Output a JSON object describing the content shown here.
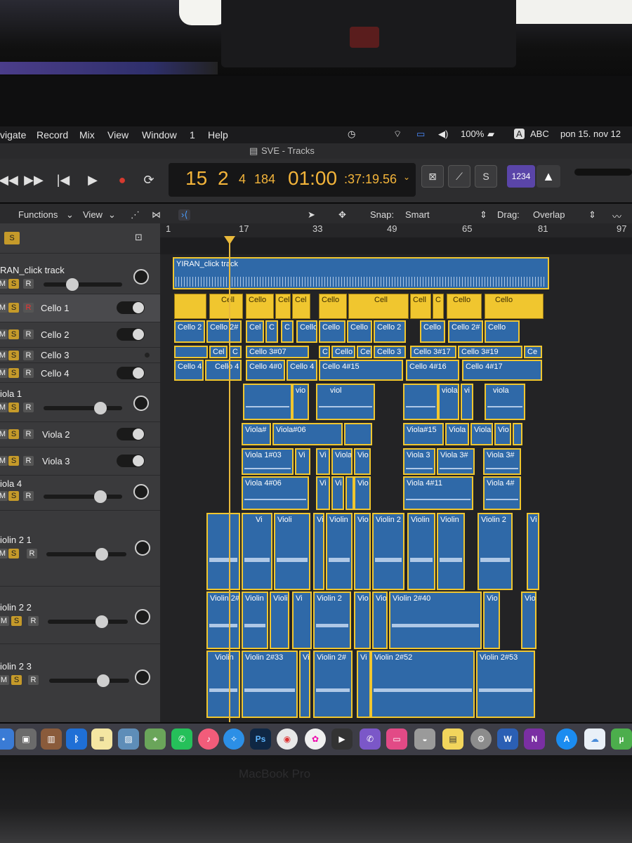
{
  "menubar": {
    "items": [
      "vigate",
      "Record",
      "Mix",
      "View",
      "Window",
      "1",
      "Help"
    ],
    "battery": "100%",
    "input_source": "ABC",
    "datetime": "pon 15. nov 12"
  },
  "window": {
    "title": "SVE - Tracks"
  },
  "lcd": {
    "bar": "15",
    "beat": "2",
    "div": "4",
    "tick": "184",
    "time_main": "01:00",
    "time_rest": ":37:19.56"
  },
  "transport": {
    "purple_button": "1234"
  },
  "edit_toolbar": {
    "functions": "Functions",
    "view": "View",
    "snap_label": "Snap:",
    "snap_value": "Smart",
    "drag_label": "Drag:",
    "drag_value": "Overlap"
  },
  "ruler": [
    "1",
    "17",
    "33",
    "49",
    "65",
    "81",
    "97"
  ],
  "tracks": [
    {
      "name": "RAN_click track"
    },
    {
      "name": "Cello 1"
    },
    {
      "name": "Cello 2"
    },
    {
      "name": "Cello 3"
    },
    {
      "name": "Cello 4"
    },
    {
      "name": "iola 1"
    },
    {
      "name": "Viola 2"
    },
    {
      "name": "Viola 3"
    },
    {
      "name": "iola 4"
    },
    {
      "name": "iolin 2 1"
    },
    {
      "name": "iolin 2 2"
    },
    {
      "name": "iolin 2 3"
    }
  ],
  "regions": {
    "click": "YIRAN_click track",
    "cello1": [
      "Cell",
      "Cello",
      "Cel",
      "Cel",
      "Cello",
      "Cell",
      "Cell",
      "C",
      "Cello",
      "Cello"
    ],
    "cello2": [
      "Cello 2",
      "Cello 2#",
      "Cel",
      "C",
      "C",
      "Cello",
      "Cello",
      "Cello",
      "Cello 2",
      "Cello",
      "Cello 2#",
      "Cello"
    ],
    "cello3": [
      "Cel",
      "C",
      "Cello 3#07",
      "C",
      "Cello",
      "Cel",
      "Cello 3",
      "Cello 3#17",
      "Cello 3#19",
      "Ce"
    ],
    "cello4": [
      "Cello 4",
      "Cello 4",
      "Cello 4#0",
      "Cello 4",
      "Cello 4#15",
      "Cello 4#16",
      "Cello 4#17"
    ],
    "viola1": [
      "vio",
      "viol",
      "viola",
      "vi",
      "viola"
    ],
    "viola2": [
      "Viola#",
      "Viola#06",
      "Viola#15",
      "Viola",
      "Viola",
      "Vio"
    ],
    "viola3": [
      "Viola 1#03",
      "Vi",
      "Vi",
      "Viola",
      "Vio",
      "Viola 3",
      "Viola 3#",
      "Viola 3#"
    ],
    "viola4": [
      "Viola 4#06",
      "Vi",
      "Vi",
      "Vio",
      "Viola 4#11",
      "Viola 4#"
    ],
    "violin21": [
      "Vi",
      "Violi",
      "Vi",
      "Violin",
      "Vio",
      "Violin 2",
      "Violin",
      "Violin",
      "Violin 2",
      "Vi"
    ],
    "violin22": [
      "Violin 2#",
      "Violin",
      "Violi",
      "Vi",
      "Violin 2",
      "Vio",
      "Vio",
      "Violin 2#40",
      "Vio",
      "Vio"
    ],
    "violin23": [
      "Violin",
      "Violin 2#33",
      "Vi",
      "Violin 2#",
      "Vi",
      "Violin 2#52",
      "Violin 2#53"
    ]
  },
  "dock": {
    "apps": [
      "Messages",
      "Photo Booth",
      "Bluetooth",
      "Notes",
      "Preview",
      "Maps",
      "WhatsApp",
      "Music",
      "Safari",
      "Photoshop",
      "Chrome",
      "Photos",
      "Final Cut",
      "Viber",
      "Stage",
      "Disk",
      "Stickies",
      "Prefs",
      "Word",
      "OneNote",
      "App Store",
      "iCloud",
      "uTorrent"
    ]
  },
  "bottom_label": "MacBook Pro"
}
